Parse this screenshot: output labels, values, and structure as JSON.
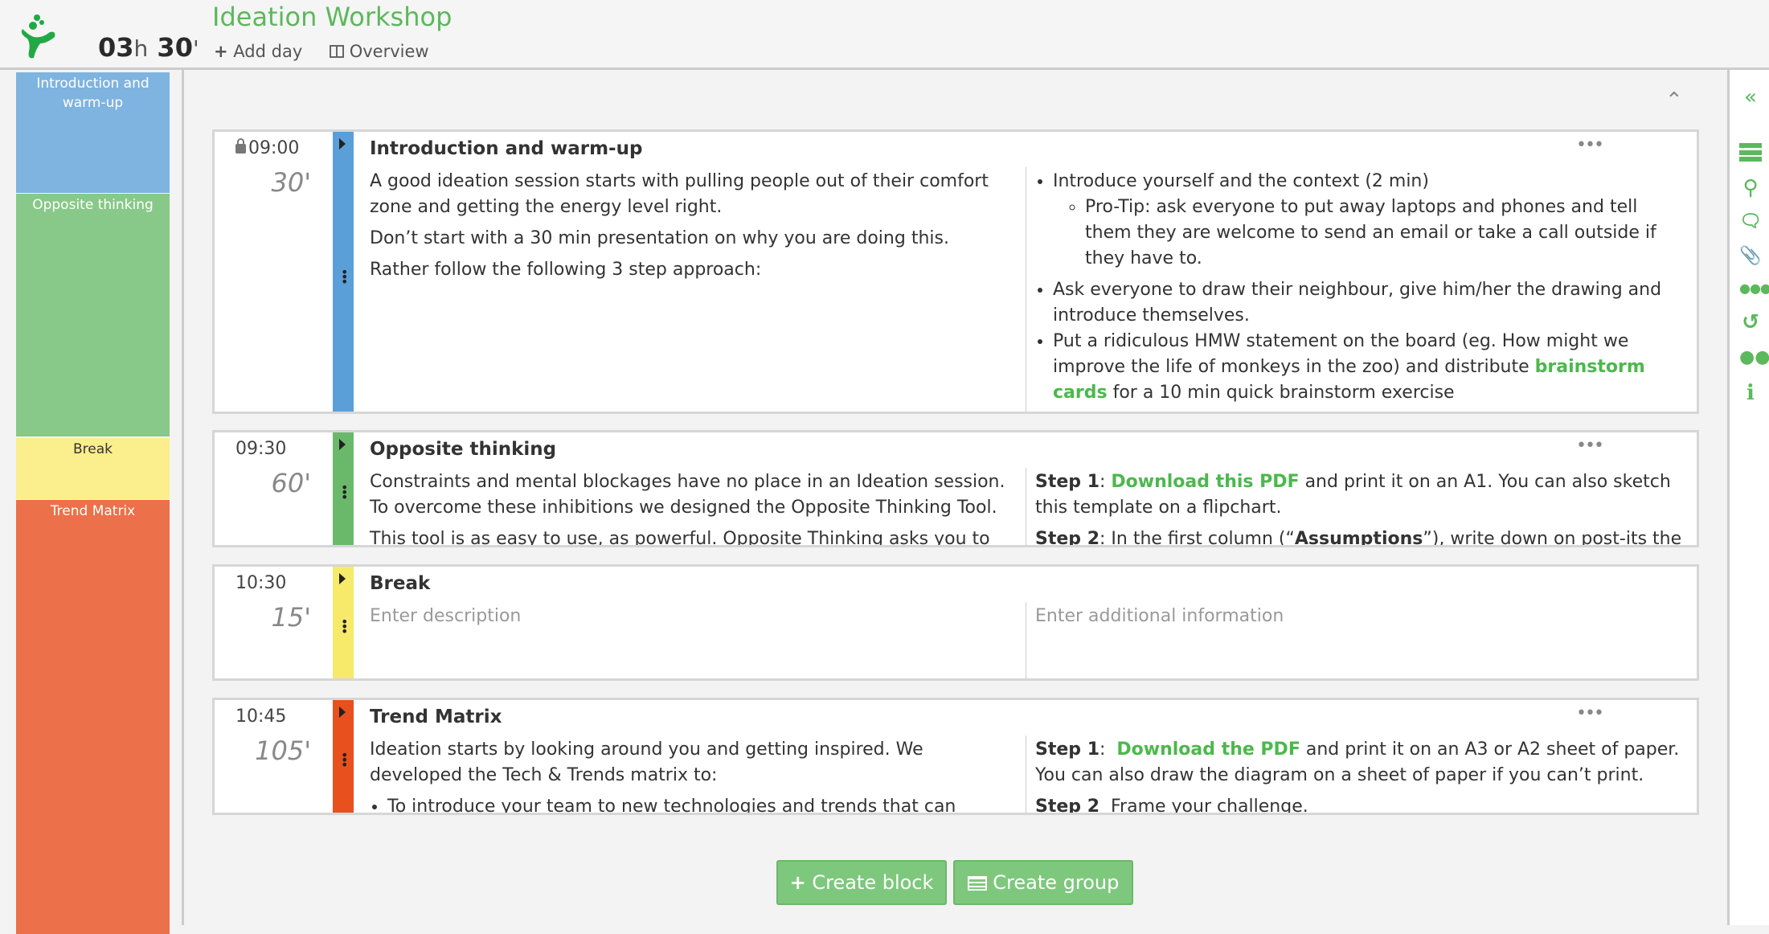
{
  "header": {
    "title": "Ideation Workshop",
    "duration_hours": "03",
    "duration_h_unit": "h",
    "duration_minutes": "30",
    "duration_m_unit": "'",
    "add_day": "Add day",
    "overview": "Overview"
  },
  "colors": {
    "accent": "#5cb85c",
    "intro": "#5b9fd8",
    "opposite": "#6ab96a",
    "break": "#f7ea6a",
    "trend": "#e8501e"
  },
  "sidebar": {
    "items": [
      {
        "label": "Introduction and warm-up"
      },
      {
        "label": "Opposite thinking"
      },
      {
        "label": "Break"
      },
      {
        "label": "Trend Matrix"
      }
    ]
  },
  "right_toolbar": [
    "collapse-icon",
    "blocks-icon",
    "search-icon",
    "comments-icon",
    "attachment-icon",
    "more-icon",
    "history-icon",
    "team-icon",
    "info-icon"
  ],
  "blocks": [
    {
      "time": "09:00",
      "locked": true,
      "duration": "30'",
      "title": "Introduction and warm-up",
      "desc": [
        "A good ideation session starts with pulling people out of their comfort zone and getting the energy level right.",
        "Don’t start with a 30 min presentation on why you are doing this.",
        "Rather follow the following 3 step approach:"
      ],
      "info": {
        "b1": "Introduce yourself and the context (2 min)",
        "b1_sub": "Pro-Tip: ask everyone to put away laptops and phones and tell them they are welcome to send an email or take a call outside if they have to.",
        "b2": "Ask everyone to draw their neighbour, give him/her the drawing and introduce themselves.",
        "b3_pre": "Put a ridiculous HMW statement on the board (eg. How might we improve the life of monkeys in the zoo) and distribute ",
        "b3_link": "brainstorm cards",
        "b3_post": " for a 10 min quick brainstorm exercise"
      }
    },
    {
      "time": "09:30",
      "duration": "60'",
      "title": "Opposite thinking",
      "desc": [
        "Constraints and mental blockages have no place in an Ideation session. To overcome these inhibitions we designed the Opposite Thinking Tool.",
        "This tool is as easy to use, as powerful. Opposite Thinking asks you to"
      ],
      "info": {
        "s1": "Step 1",
        "s1_link": "Download this PDF",
        "s1_text": " and print it on an A1. You can also sketch this template on a flipchart.",
        "s2": "Step 2",
        "s2_a": ": In the first column (“",
        "s2_b": "Assumptions",
        "s2_c": "”), write down on post-its the"
      }
    },
    {
      "time": "10:30",
      "duration": "15'",
      "title": "Break",
      "desc_placeholder": "Enter description",
      "info_placeholder": "Enter additional information"
    },
    {
      "time": "10:45",
      "duration": "105'",
      "title": "Trend Matrix",
      "desc": [
        "Ideation starts by looking around you and getting inspired. We developed the Tech & Trends matrix to:"
      ],
      "desc_bullet": "To introduce your team to new technologies and trends that can",
      "info": {
        "s1": "Step 1",
        "s1_link": "Download the PDF",
        "s1_text": " and print it on an A3 or A2 sheet of paper. You can also draw the diagram on a sheet of paper if you can’t print.",
        "s2": "Step 2",
        "s2_text": "Frame your challenge."
      }
    }
  ],
  "footer": {
    "create_block": "Create block",
    "create_group": "Create group"
  }
}
